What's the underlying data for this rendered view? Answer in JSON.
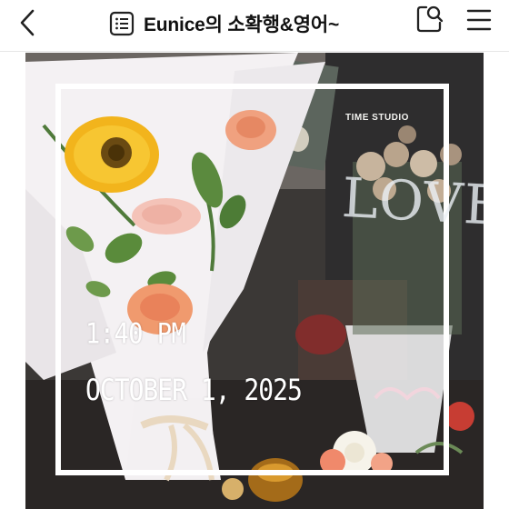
{
  "header": {
    "title": "Eunice의 소확행&영어~",
    "back_icon": "chevron-left-icon",
    "list_icon": "list-icon",
    "search_icon": "search-icon",
    "menu_icon": "hamburger-menu-icon"
  },
  "photo": {
    "time_stamp": "1:40 PM",
    "date_stamp": "OCTOBER 1, 2025",
    "shop_logo_text": "TIME STUDIO",
    "sign_text": "LOVE."
  },
  "colors": {
    "accent_text": "#111111",
    "stamp_text": "#ffffff",
    "sunflower": "#f2b41c",
    "carnation_peach": "#f09a6e",
    "carnation_pink": "#f4c3b8"
  }
}
